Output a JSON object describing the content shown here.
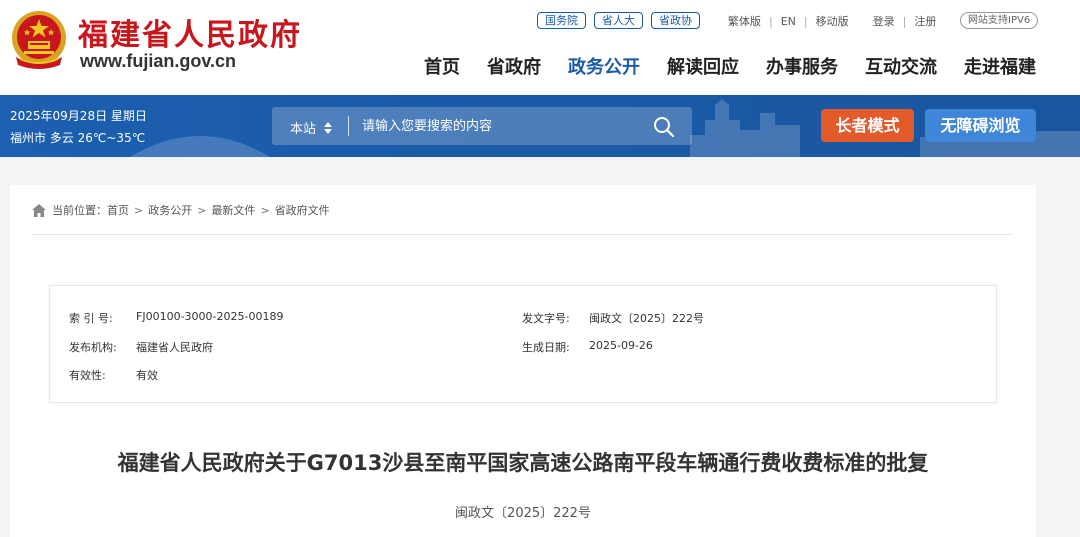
{
  "header": {
    "site_title": "福建省人民政府",
    "site_url": "www.fujian.gov.cn",
    "gov_links": [
      "国务院",
      "省人大",
      "省政协"
    ],
    "util": {
      "traditional": "繁体版",
      "english": "EN",
      "mobile": "移动版",
      "login": "登录",
      "register": "注册"
    },
    "ipv6": "网站支持IPV6",
    "nav": [
      "首页",
      "省政府",
      "政务公开",
      "解读回应",
      "办事服务",
      "互动交流",
      "走进福建"
    ],
    "nav_active": "政务公开"
  },
  "bar": {
    "date": "2025年09月28日 星期日",
    "weather": "福州市 多云 26℃~35℃",
    "scope": "本站",
    "search_placeholder": "请输入您要搜索的内容",
    "elder_mode": "长者模式",
    "accessible": "无障碍浏览"
  },
  "breadcrumb": {
    "label": "当前位置：",
    "items": [
      "首页",
      "政务公开",
      "最新文件",
      "省政府文件"
    ]
  },
  "meta": {
    "index_label": "索 引 号:",
    "index_value": "FJ00100-3000-2025-00189",
    "doc_no_label": "发文字号:",
    "doc_no_value": "闽政文〔2025〕222号",
    "org_label": "发布机构:",
    "org_value": "福建省人民政府",
    "date_label": "生成日期:",
    "date_value": "2025-09-26",
    "validity_label": "有效性:",
    "validity_value": "有效"
  },
  "document": {
    "title": "福建省人民政府关于G7013沙县至南平国家高速公路南平段车辆通行费收费标准的批复",
    "doc_no": "闽政文〔2025〕222号"
  },
  "colors": {
    "brand_red": "#c8161d",
    "brand_blue": "#1a5ba8",
    "elder_orange": "#e35b2b",
    "access_blue": "#3f86d8"
  }
}
